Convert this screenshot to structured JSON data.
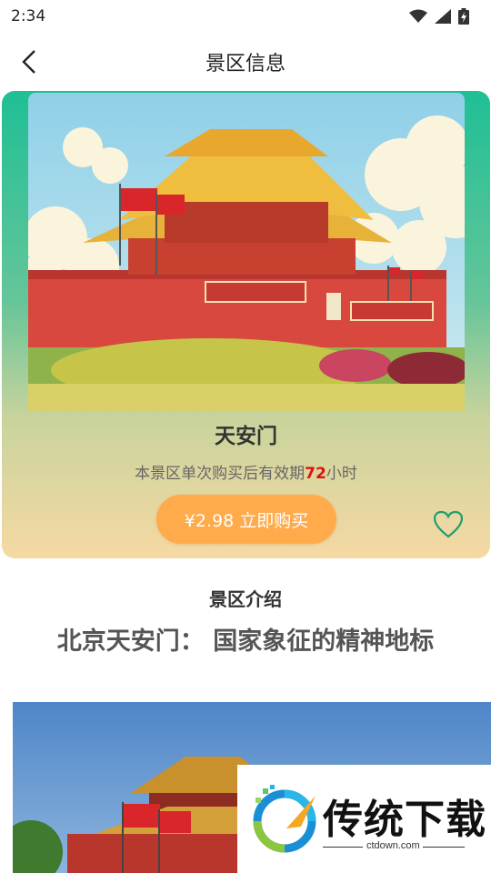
{
  "status_bar": {
    "time": "2:34"
  },
  "header": {
    "title": "景区信息"
  },
  "spot": {
    "name": "天安门",
    "validity_prefix": "本景区单次购买后有效期",
    "validity_hours": "72",
    "validity_suffix": "小时",
    "buy_label": "¥2.98 立即购买"
  },
  "intro": {
    "heading": "景区介绍",
    "title": "北京天安门： 国家象征的精神地标"
  },
  "watermark": {
    "brand": "传统下载",
    "url": "ctdown.com"
  },
  "colors": {
    "accent_teal": "#1fbf95",
    "buy_orange": "#ffab4c",
    "highlight_red": "#e01010"
  }
}
